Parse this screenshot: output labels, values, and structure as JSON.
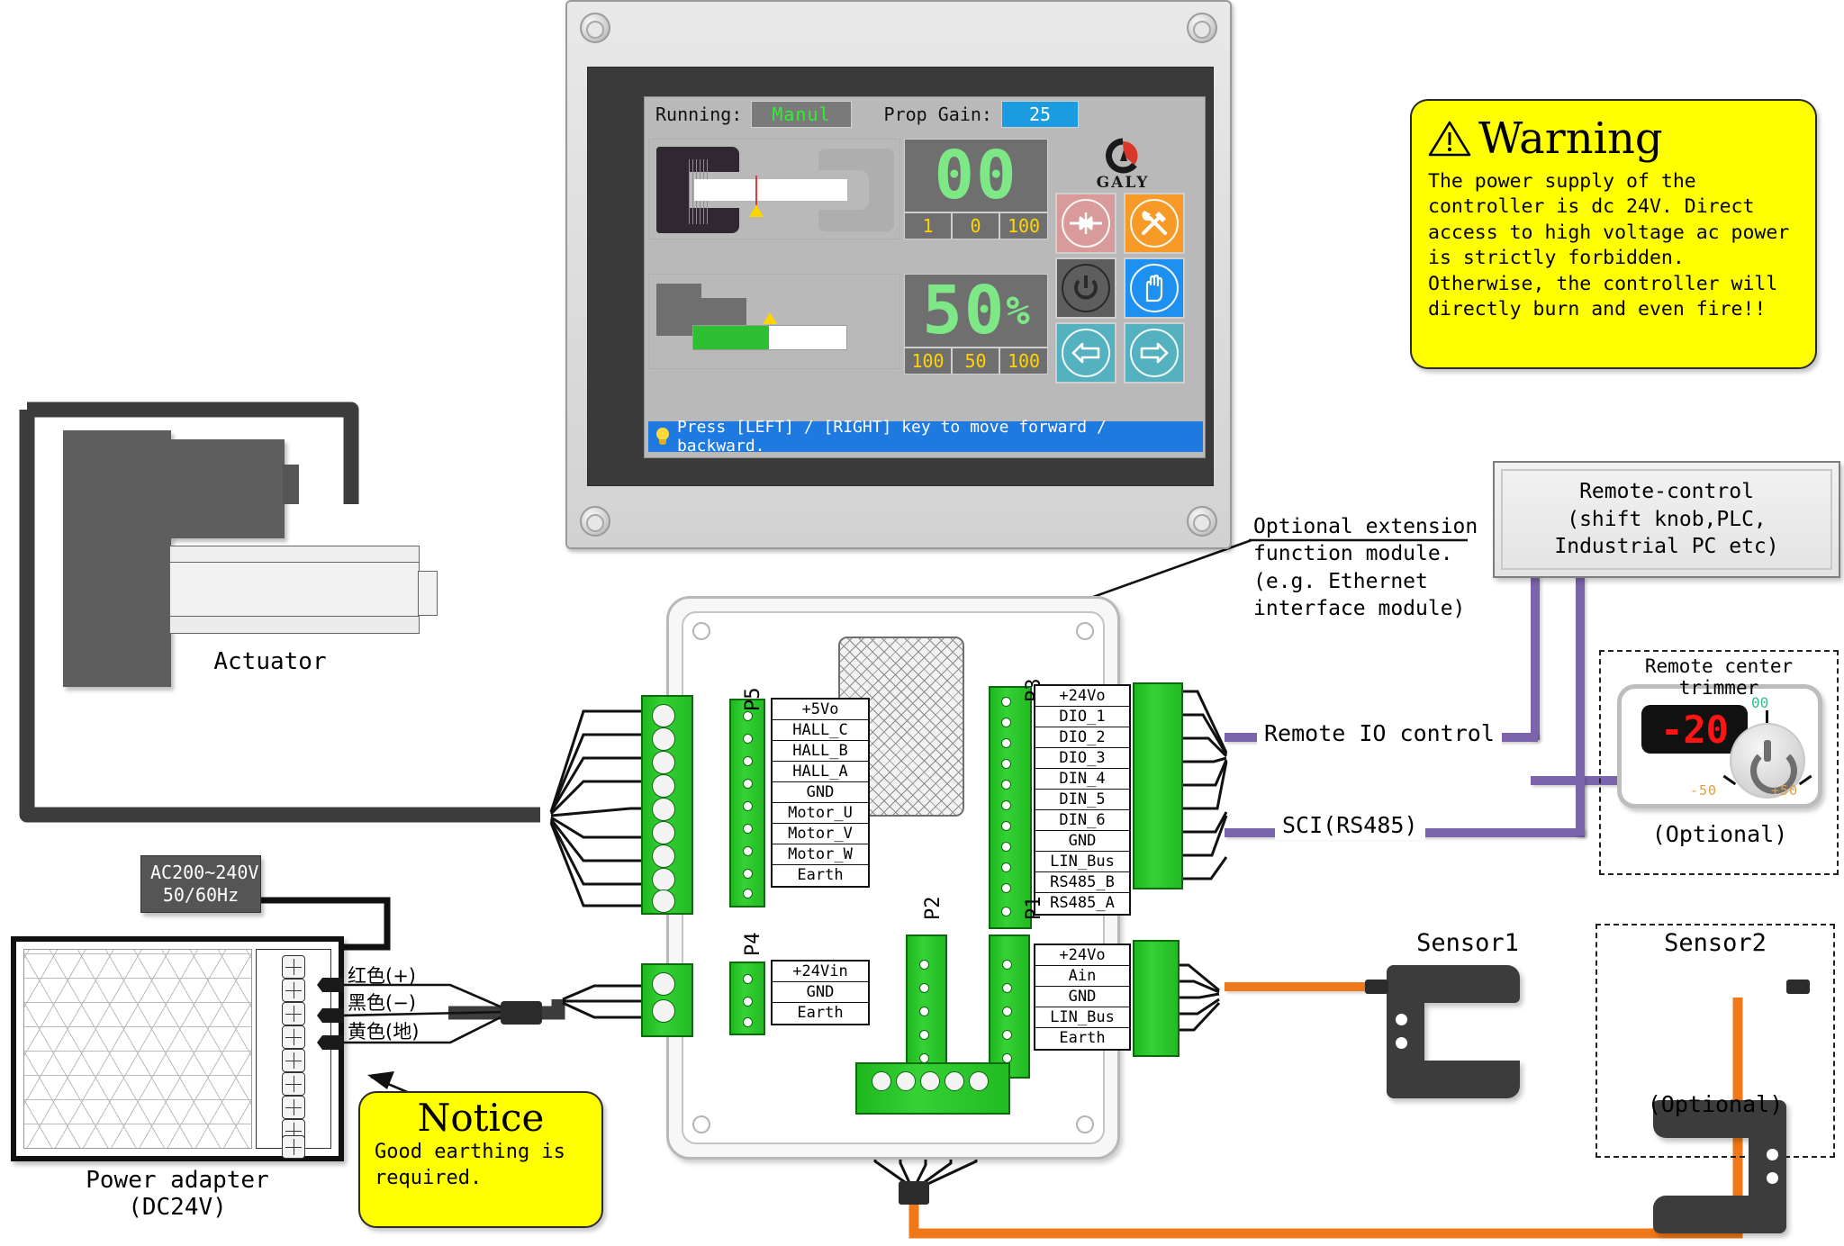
{
  "hmi": {
    "running_label": "Running:",
    "running_value": "Manul",
    "gain_label": "Prop Gain:",
    "gain_value": "25",
    "position_display": "00",
    "position_triplet": [
      "1",
      "0",
      "100"
    ],
    "speed_display": "50",
    "speed_unit": "%",
    "speed_triplet": [
      "100",
      "50",
      "100"
    ],
    "status_text": "Press [LEFT] / [RIGHT] key to move forward / backward.",
    "brand": "GALY",
    "buttons": [
      {
        "name": "center-align-button",
        "icon": "arrows-to-center-icon",
        "color": "#d99a9a"
      },
      {
        "name": "tools-button",
        "icon": "hammer-wrench-icon",
        "color": "#f89a27"
      },
      {
        "name": "power-button",
        "icon": "power-icon",
        "color": "#5e5e5e"
      },
      {
        "name": "manual-hand-button",
        "icon": "hand-icon",
        "color": "#1e90f0"
      },
      {
        "name": "move-left-button",
        "icon": "arrow-left-icon",
        "color": "#54b2c0"
      },
      {
        "name": "move-right-button",
        "icon": "arrow-right-icon",
        "color": "#54b2c0"
      }
    ]
  },
  "warning": {
    "title": "Warning",
    "lines": [
      "The power supply of the",
      "controller is dc 24V. Direct",
      "access to high voltage ac power",
      "is strictly forbidden.",
      "Otherwise, the controller will",
      "directly burn and even fire!!"
    ]
  },
  "notice": {
    "title": "Notice",
    "lines": [
      "Good earthing is",
      "required."
    ]
  },
  "board": {
    "ext_module_note": [
      "Optional extension",
      "function module.",
      "(e.g. Ethernet",
      "interface module)"
    ],
    "connectors": [
      {
        "name": "P5",
        "labels": [
          "+5Vo",
          "HALL_C",
          "HALL_B",
          "HALL_A",
          "GND",
          "Motor_U",
          "Motor_V",
          "Motor_W",
          "Earth"
        ]
      },
      {
        "name": "P3",
        "labels": [
          "+24Vo",
          "DIO_1",
          "DIO_2",
          "DIO_3",
          "DIN_4",
          "DIN_5",
          "DIN_6",
          "GND",
          "LIN_Bus",
          "RS485_B",
          "RS485_A"
        ]
      },
      {
        "name": "P4",
        "labels": [
          "+24Vin",
          "GND",
          "Earth"
        ]
      },
      {
        "name": "P1",
        "labels": [
          "+24Vo",
          "Ain",
          "GND",
          "LIN_Bus",
          "Earth"
        ]
      },
      {
        "name": "P2",
        "labels": []
      }
    ]
  },
  "right_panel": {
    "remote_control_lines": [
      "Remote-control",
      "(shift knob,PLC,",
      "Industrial PC etc)"
    ],
    "remote_io_label": "Remote IO control",
    "sci_label": "SCI(RS485)",
    "trimmer_title": "Remote center trimmer",
    "trimmer_value": "-20",
    "trimmer_center_mark": "00",
    "trimmer_min": "-50",
    "trimmer_max": "+50",
    "trimmer_optional": "(Optional)",
    "sensor1_label": "Sensor1",
    "sensor2_label": "Sensor2",
    "sensor2_optional": "(Optional)"
  },
  "left_panel": {
    "actuator_label": "Actuator",
    "ac_input_lines": [
      "AC200~240V",
      "50/60Hz"
    ],
    "psu_caption_lines": [
      "Power adapter",
      "(DC24V)"
    ],
    "wire_labels": [
      "红色(+)",
      "黑色(−)",
      "黄色(地)"
    ]
  },
  "colors": {
    "accent_blue": "#1b9be0",
    "seg_green": "#7ee887",
    "warn_yellow": "#ffff00",
    "terminal_green": "#2bc72b",
    "purple_wire": "#7b64ac",
    "orange_wire": "#f07818"
  }
}
